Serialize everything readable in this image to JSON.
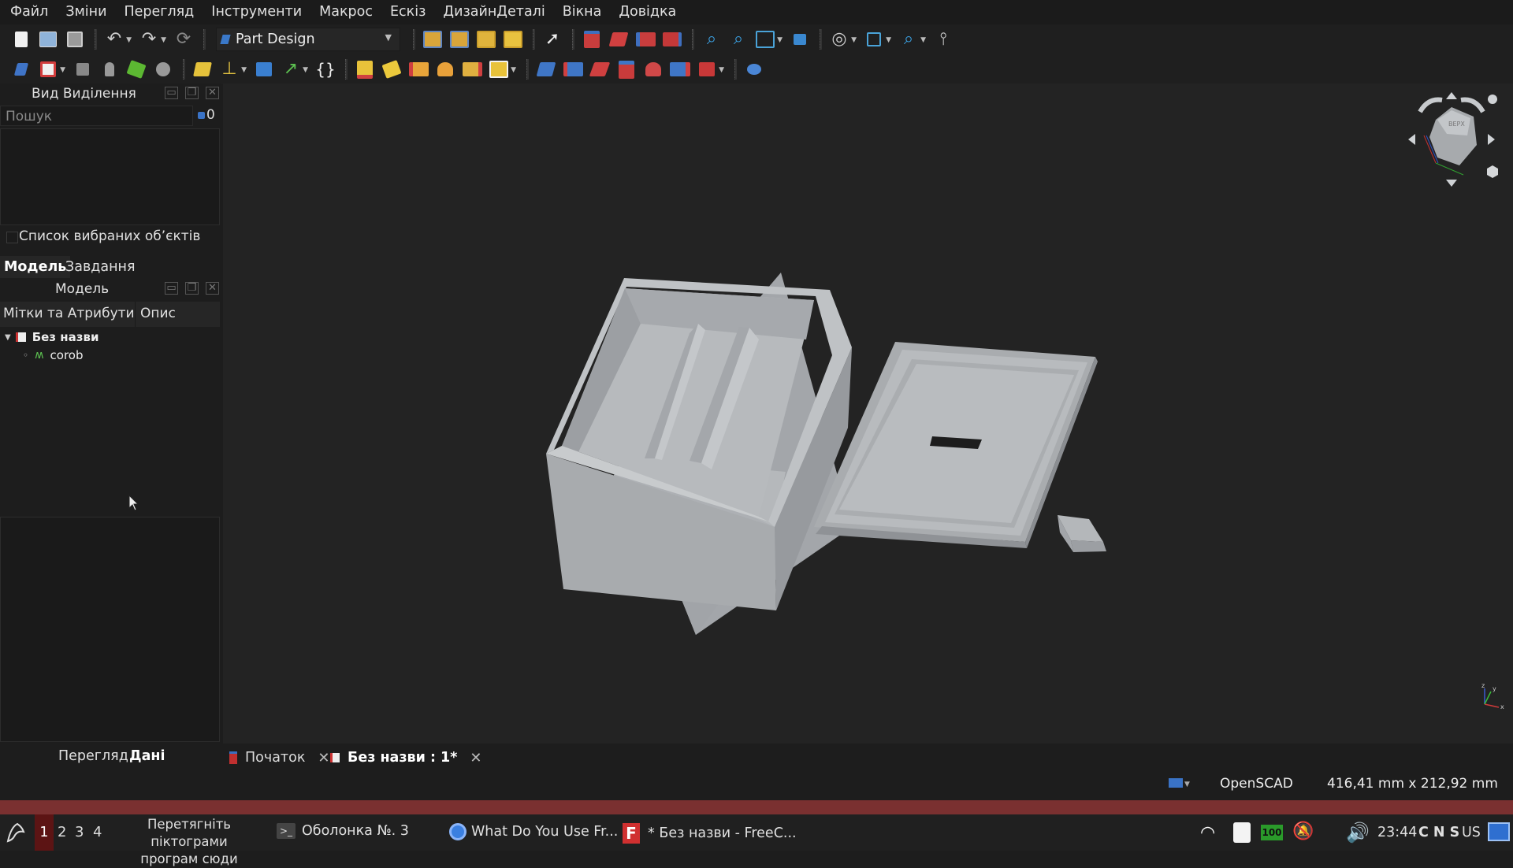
{
  "menu": [
    "Файл",
    "Зміни",
    "Перегляд",
    "Інструменти",
    "Макрос",
    "Ескіз",
    "ДизайнДеталі",
    "Вікна",
    "Довідка"
  ],
  "toolbar": {
    "workbench": "Part Design",
    "icons_row1": [
      "new-document-icon",
      "open-document-icon",
      "save-icon",
      "undo-icon",
      "redo-icon",
      "refresh-icon",
      "new-body-icon",
      "new-sketch-icon",
      "attach-sketch-icon",
      "validate-sketch-icon",
      "select-arrow-icon",
      "view-front-icon",
      "view-top-icon",
      "view-right-icon",
      "view-rear-icon",
      "fit-all-icon",
      "fit-selection-icon",
      "standard-views-icon",
      "box-zoom-icon",
      "draw-style-icon",
      "isometric-view-icon",
      "zoom-icon",
      "measure-icon"
    ],
    "icons_row2": [
      "body-icon",
      "part-icon",
      "clone-icon",
      "shape-binder-icon",
      "sub-shape-binder-icon",
      "datum-icon",
      "pad-icon",
      "axis-icon",
      "folder-icon",
      "link-icon",
      "expression-icon",
      "pad-feature-icon",
      "pocket-feature-icon",
      "hole-icon",
      "revolution-icon",
      "groove-icon",
      "additive-primitive-icon",
      "fillet-icon",
      "chamfer-icon",
      "draft-icon",
      "thickness-icon",
      "subtractive-icon",
      "mirror-icon",
      "boolean-icon"
    ]
  },
  "selection_view": {
    "title": "Вид Виділення",
    "search_placeholder": "Пошук",
    "count": "0",
    "picked_list_label": "Список вибраних об’єктів"
  },
  "tabs": [
    "Модель",
    "Завдання"
  ],
  "model_panel": {
    "title": "Модель",
    "col_labels": "Мітки та Атрибути",
    "col_desc": "Опис",
    "tree": [
      {
        "label": "Без назви"
      },
      {
        "label": "corob"
      }
    ]
  },
  "property_tabs": [
    "Перегляд",
    "Дані"
  ],
  "doc_tabs": [
    "Початок",
    "Без назви : 1*"
  ],
  "status": {
    "navigation": "OpenSCAD",
    "dimensions": "416,41 mm x 212,92 mm"
  },
  "navcube": {
    "face": "ВЕРХ"
  },
  "axes": {
    "x": "x",
    "y": "y",
    "z": "z"
  },
  "taskbar": {
    "workspaces": [
      "1",
      "2",
      "3",
      "4"
    ],
    "hint_line1": "Перетягніть піктограми",
    "hint_line2": "програм сюди",
    "tasks": [
      "Оболонка №. 3",
      "What Do You Use Fr...",
      "* Без назви - FreeC..."
    ],
    "battery": "100",
    "clock": "23:44",
    "indicators": "C N S",
    "layout": "US"
  },
  "colors": {
    "accent": "#3a73c6",
    "model_gray": "#b7b9bc",
    "taskbar_active": "#5c1414"
  }
}
